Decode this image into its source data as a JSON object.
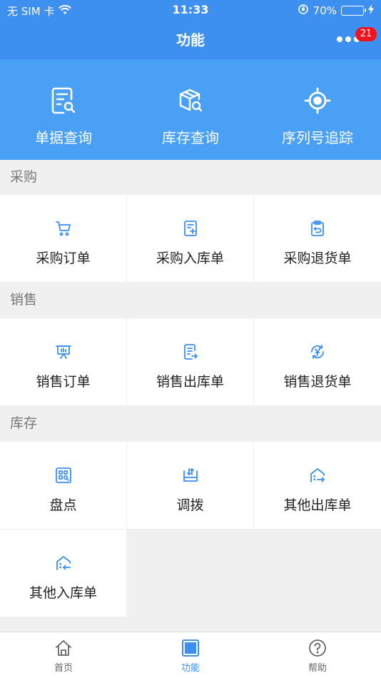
{
  "status": {
    "carrier": "无 SIM 卡",
    "time": "11:33",
    "battery_percent": "70%",
    "battery_level": 0.7
  },
  "nav": {
    "title": "功能",
    "badge": "21"
  },
  "hero": {
    "items": [
      {
        "label": "单据查询",
        "icon": "document-search-icon"
      },
      {
        "label": "库存查询",
        "icon": "box-search-icon"
      },
      {
        "label": "序列号追踪",
        "icon": "target-icon"
      }
    ]
  },
  "sections": [
    {
      "title": "采购",
      "items": [
        {
          "label": "采购订单",
          "icon": "cart-icon"
        },
        {
          "label": "采购入库单",
          "icon": "document-add-icon"
        },
        {
          "label": "采购退货单",
          "icon": "clipboard-return-icon"
        }
      ]
    },
    {
      "title": "销售",
      "items": [
        {
          "label": "销售订单",
          "icon": "presentation-icon"
        },
        {
          "label": "销售出库单",
          "icon": "document-export-icon"
        },
        {
          "label": "销售退货单",
          "icon": "yen-refresh-icon"
        }
      ]
    },
    {
      "title": "库存",
      "items": [
        {
          "label": "盘点",
          "icon": "inventory-scan-icon"
        },
        {
          "label": "调拨",
          "icon": "transfer-icon"
        },
        {
          "label": "其他出库单",
          "icon": "warehouse-out-icon"
        },
        {
          "label": "其他入库单",
          "icon": "warehouse-in-icon"
        }
      ]
    }
  ],
  "tabs": [
    {
      "label": "首页",
      "icon": "home-icon"
    },
    {
      "label": "功能",
      "icon": "grid-icon",
      "active": true
    },
    {
      "label": "帮助",
      "icon": "help-icon"
    }
  ],
  "colors": {
    "primary": "#3d8ff0",
    "hero_bg": "#49a0f5",
    "icon_blue": "#3d8ff0",
    "badge": "#f0141e"
  }
}
